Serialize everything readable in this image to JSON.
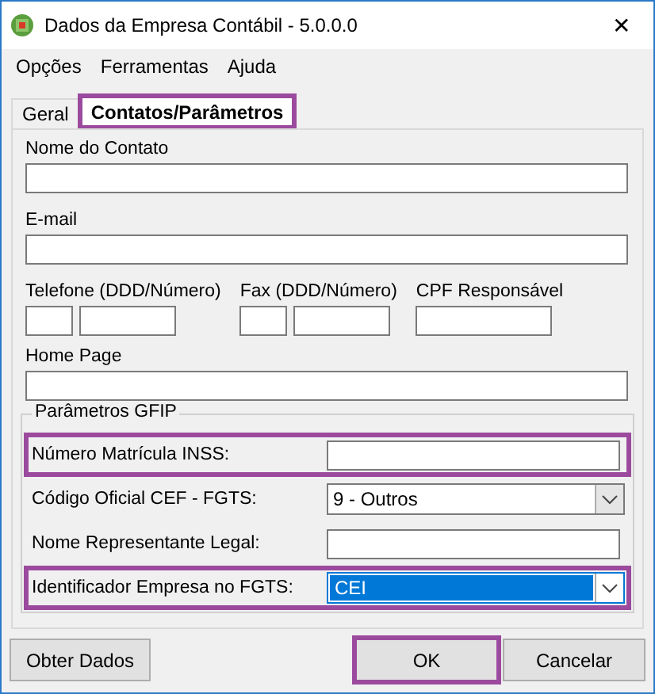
{
  "window": {
    "title": "Dados da Empresa Contábil - 5.0.0.0",
    "close": "✕"
  },
  "menu": [
    "Opções",
    "Ferramentas",
    "Ajuda"
  ],
  "tabs": [
    {
      "label": "Geral",
      "selected": false,
      "highlighted": false
    },
    {
      "label": "Contatos/Parâmetros",
      "selected": true,
      "highlighted": true
    }
  ],
  "contact": {
    "name_label": "Nome do Contato",
    "email_label": "E-mail",
    "phone_label": "Telefone (DDD/Número)",
    "fax_label": "Fax (DDD/Número)",
    "cpf_label": "CPF Responsável",
    "homepage_label": "Home Page"
  },
  "gfip": {
    "title": "Parâmetros GFIP",
    "rows": [
      {
        "kind": "text",
        "label": "Número Matrícula INSS:",
        "highlighted": true
      },
      {
        "kind": "combo",
        "label": "Código Oficial CEF - FGTS:",
        "value": "9 - Outros",
        "focused": false,
        "highlighted": false
      },
      {
        "kind": "text",
        "label": "Nome Representante Legal:",
        "highlighted": false
      },
      {
        "kind": "combo",
        "label": "Identificador Empresa no FGTS:",
        "value": "CEI",
        "focused": true,
        "highlighted": true
      }
    ]
  },
  "buttons": [
    {
      "label": "Obter Dados",
      "highlighted": false
    },
    {
      "label": "OK",
      "highlighted": true
    },
    {
      "label": "Cancelar",
      "highlighted": false
    }
  ]
}
